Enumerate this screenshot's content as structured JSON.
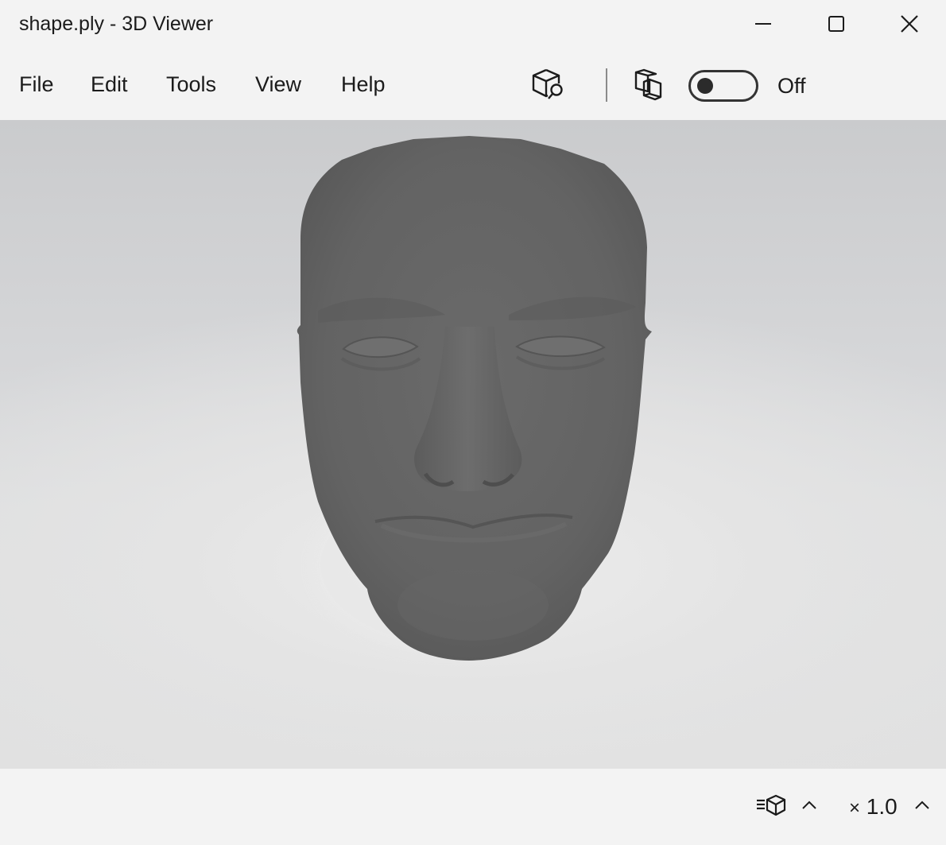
{
  "window": {
    "title": "shape.ply - 3D Viewer",
    "minimize_icon": "minimize-icon",
    "maximize_icon": "maximize-icon",
    "close_icon": "close-icon"
  },
  "menu": {
    "items": [
      {
        "label": "File"
      },
      {
        "label": "Edit"
      },
      {
        "label": "Tools"
      },
      {
        "label": "View"
      },
      {
        "label": "Help"
      }
    ]
  },
  "toolbar": {
    "inspect_icon": "cube-search-icon",
    "view_mode_icon": "cube-outline-icon",
    "toggle_state": "Off",
    "toggle_on": false
  },
  "viewport": {
    "model": "3D face mesh",
    "model_color": "#636363",
    "background_color": "#d8d9db"
  },
  "statusbar": {
    "mode_icon": "cube-list-icon",
    "zoom_prefix": "×",
    "zoom_value": "1.0"
  }
}
